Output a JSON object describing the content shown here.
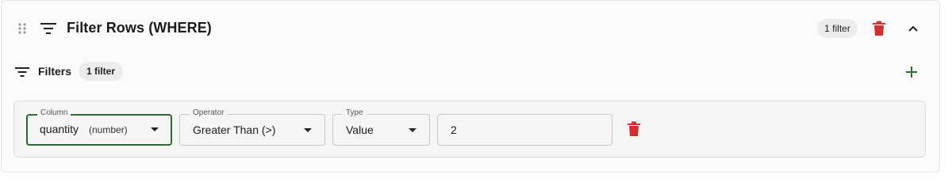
{
  "header": {
    "title": "Filter Rows (WHERE)",
    "badge": "1 filter",
    "icons": {
      "drag": "drag-handle-icon",
      "filter": "filter-icon",
      "delete": "trash-icon",
      "collapse": "chevron-up-icon"
    }
  },
  "filters": {
    "label": "Filters",
    "badge": "1 filter",
    "icons": {
      "filter": "filter-icon",
      "add": "plus-icon"
    }
  },
  "filter_row": {
    "column": {
      "legend": "Column",
      "value": "quantity",
      "type_hint": "(number)"
    },
    "operator": {
      "legend": "Operator",
      "value": "Greater Than (>)"
    },
    "type": {
      "legend": "Type",
      "value": "Value"
    },
    "value": {
      "value": "2"
    }
  },
  "colors": {
    "accent_green": "#2e6b34",
    "delete_red": "#d32f2f",
    "badge_bg": "#ececec"
  }
}
